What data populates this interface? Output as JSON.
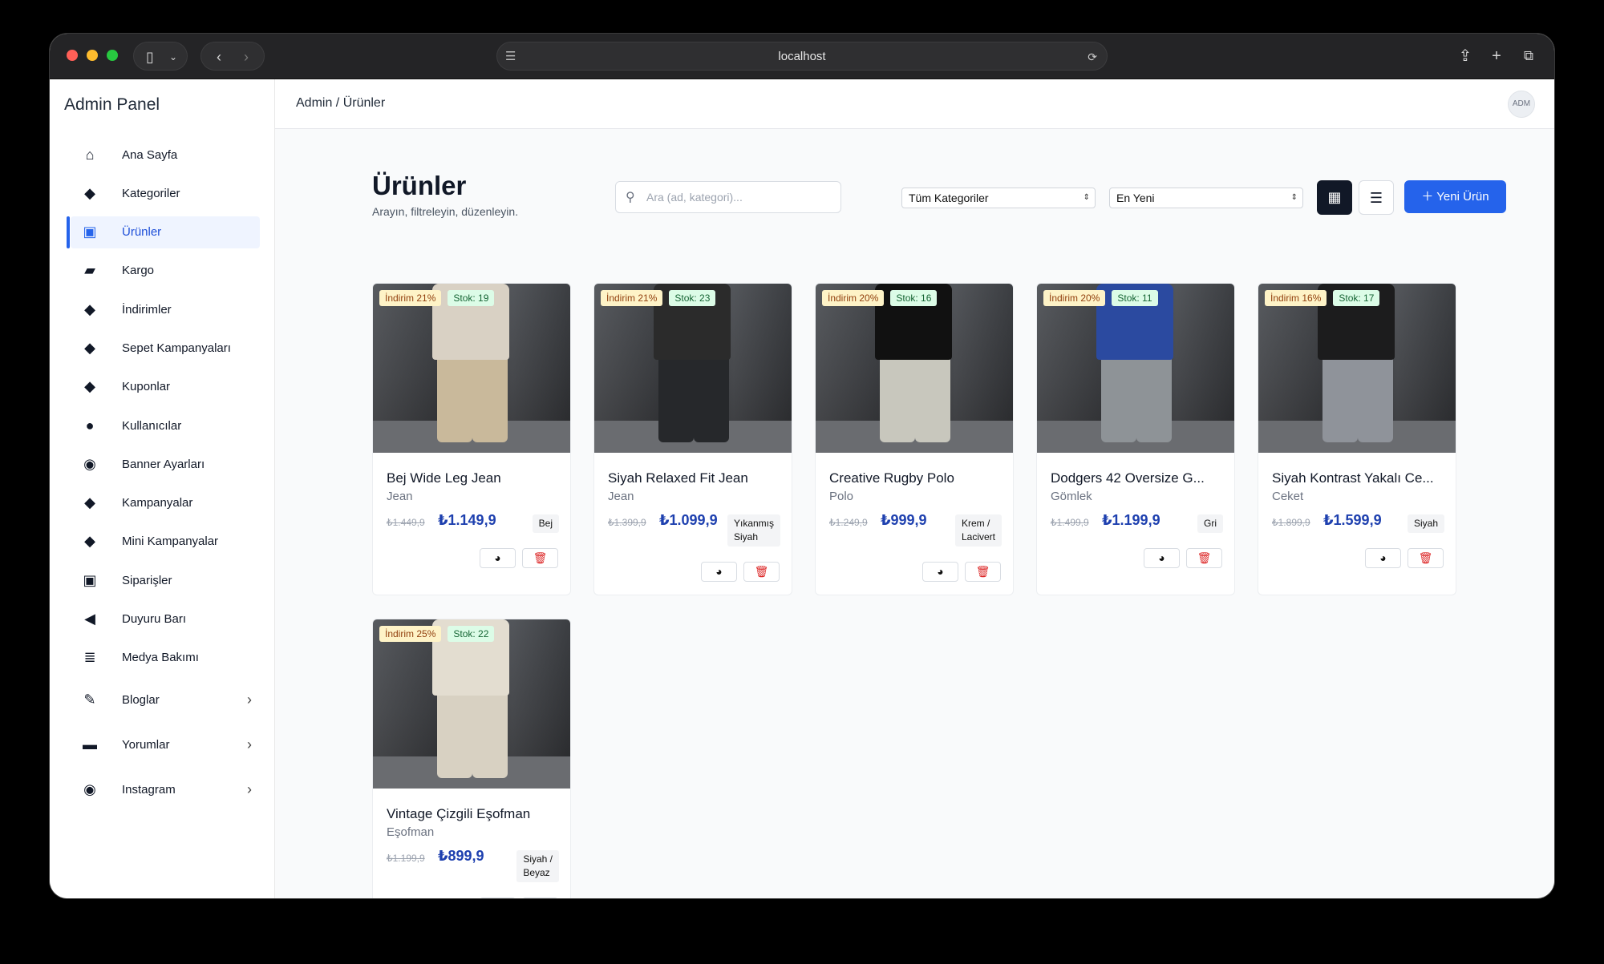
{
  "browser": {
    "url": "localhost"
  },
  "sidebar": {
    "brand": "Admin Panel",
    "items": [
      {
        "label": "Ana Sayfa",
        "icon": "home-icon"
      },
      {
        "label": "Kategoriler",
        "icon": "tag-icon"
      },
      {
        "label": "Ürünler",
        "icon": "shopping-bag-icon",
        "active": true
      },
      {
        "label": "Kargo",
        "icon": "truck-icon"
      },
      {
        "label": "İndirimler",
        "icon": "tag-icon"
      },
      {
        "label": "Sepet Kampanyaları",
        "icon": "tag-icon"
      },
      {
        "label": "Kuponlar",
        "icon": "tag-icon"
      },
      {
        "label": "Kullanıcılar",
        "icon": "user-circle-icon"
      },
      {
        "label": "Banner Ayarları",
        "icon": "camera-icon"
      },
      {
        "label": "Kampanyalar",
        "icon": "tag-icon"
      },
      {
        "label": "Mini Kampanyalar",
        "icon": "tag-icon"
      },
      {
        "label": "Siparişler",
        "icon": "shopping-bag-icon"
      },
      {
        "label": "Duyuru Barı",
        "icon": "megaphone-icon"
      },
      {
        "label": "Medya Bakımı",
        "icon": "database-icon"
      },
      {
        "label": "Bloglar",
        "icon": "pencil-icon",
        "expandable": true
      },
      {
        "label": "Yorumlar",
        "icon": "comment-icon",
        "expandable": true
      },
      {
        "label": "Instagram",
        "icon": "camera-icon",
        "expandable": true
      }
    ]
  },
  "header": {
    "breadcrumb": "Admin / Ürünler",
    "avatar": "ADM"
  },
  "page": {
    "title": "Ürünler",
    "subtitle": "Arayın, filtreleyin, düzenleyin.",
    "search_placeholder": "Ara (ad, kategori)...",
    "category_filter": "Tüm Kategoriler",
    "sort": "En Yeni",
    "new_button": "Yeni Ürün"
  },
  "products": [
    {
      "name": "Bej Wide Leg Jean",
      "category": "Jean",
      "discount": "İndirim 21%",
      "stock": "Stok: 19",
      "old_price": "₺1.449,9",
      "price": "₺1.149,9",
      "color": "Bej",
      "top": "#d9d1c4",
      "pants": "#c9b99b"
    },
    {
      "name": "Siyah Relaxed Fit Jean",
      "category": "Jean",
      "discount": "İndirim 21%",
      "stock": "Stok: 23",
      "old_price": "₺1.399,9",
      "price": "₺1.099,9",
      "color": "Yıkanmış\nSiyah",
      "top": "#2b2b2b",
      "pants": "#26282b"
    },
    {
      "name": "Creative Rugby Polo",
      "category": "Polo",
      "discount": "İndirim 20%",
      "stock": "Stok: 16",
      "old_price": "₺1.249,9",
      "price": "₺999,9",
      "color": "Krem /\nLacivert",
      "top": "#111111",
      "pants": "#c8c7bd"
    },
    {
      "name": "Dodgers 42 Oversize G...",
      "category": "Gömlek",
      "discount": "İndirim 20%",
      "stock": "Stok: 11",
      "old_price": "₺1.499,9",
      "price": "₺1.199,9",
      "color": "Gri",
      "top": "#2b4aa0",
      "pants": "#8e9397"
    },
    {
      "name": "Siyah Kontrast Yakalı Ce...",
      "category": "Ceket",
      "discount": "İndirim 16%",
      "stock": "Stok: 17",
      "old_price": "₺1.899,9",
      "price": "₺1.599,9",
      "color": "Siyah",
      "top": "#1c1c1d",
      "pants": "#8f939a"
    },
    {
      "name": "Vintage Çizgili Eşofman",
      "category": "Eşofman",
      "discount": "İndirim 25%",
      "stock": "Stok: 22",
      "old_price": "₺1.199,9",
      "price": "₺899,9",
      "color": "Siyah /\nBeyaz",
      "top": "#e3ddd0",
      "pants": "#d8d1c2"
    }
  ]
}
